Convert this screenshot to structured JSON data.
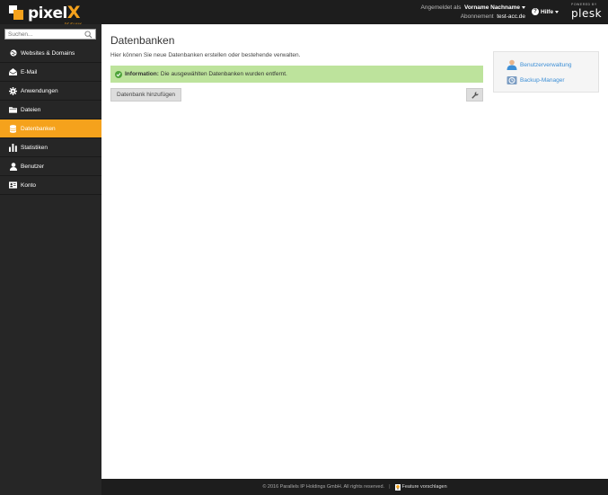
{
  "logo": {
    "text_main": "pixel",
    "text_x": "X",
    "sub": "DE/EU/UK"
  },
  "header": {
    "logged_in_label": "Angemeldet als",
    "user_name": "Vorname Nachname",
    "subscription_label": "Abonnement",
    "subscription_value": "test-acc.de",
    "help_label": "Hilfe",
    "powered_by": "POWERED BY",
    "plesk": "plesk"
  },
  "sidebar": {
    "search_placeholder": "Suchen...",
    "items": [
      {
        "label": "Websites & Domains",
        "icon": "globe-icon"
      },
      {
        "label": "E-Mail",
        "icon": "envelope-icon"
      },
      {
        "label": "Anwendungen",
        "icon": "gear-icon"
      },
      {
        "label": "Dateien",
        "icon": "folder-icon"
      },
      {
        "label": "Datenbanken",
        "icon": "database-icon",
        "active": true
      },
      {
        "label": "Statistiken",
        "icon": "bar-chart-icon"
      },
      {
        "label": "Benutzer",
        "icon": "user-icon"
      },
      {
        "label": "Konto",
        "icon": "id-card-icon"
      }
    ]
  },
  "main": {
    "title": "Datenbanken",
    "description": "Hier können Sie neue Datenbanken erstellen oder bestehende verwalten.",
    "message_label": "Information:",
    "message_text": "Die ausgewählten Datenbanken wurden entfernt.",
    "add_button": "Datenbank hinzufügen"
  },
  "side_panel": {
    "links": [
      {
        "label": "Benutzerverwaltung",
        "icon": "user-admin-icon"
      },
      {
        "label": "Backup-Manager",
        "icon": "backup-icon"
      }
    ]
  },
  "footer": {
    "copyright": "© 2016 Parallels IP Holdings GmbH. All rights reserved.",
    "separator": "|",
    "feature_label": "Feature vorschlagen"
  },
  "colors": {
    "accent": "#f5a21c",
    "topbar": "#1d1d1d",
    "sidebar": "#262626",
    "success": "#bde39c",
    "link": "#3d8fd6"
  }
}
